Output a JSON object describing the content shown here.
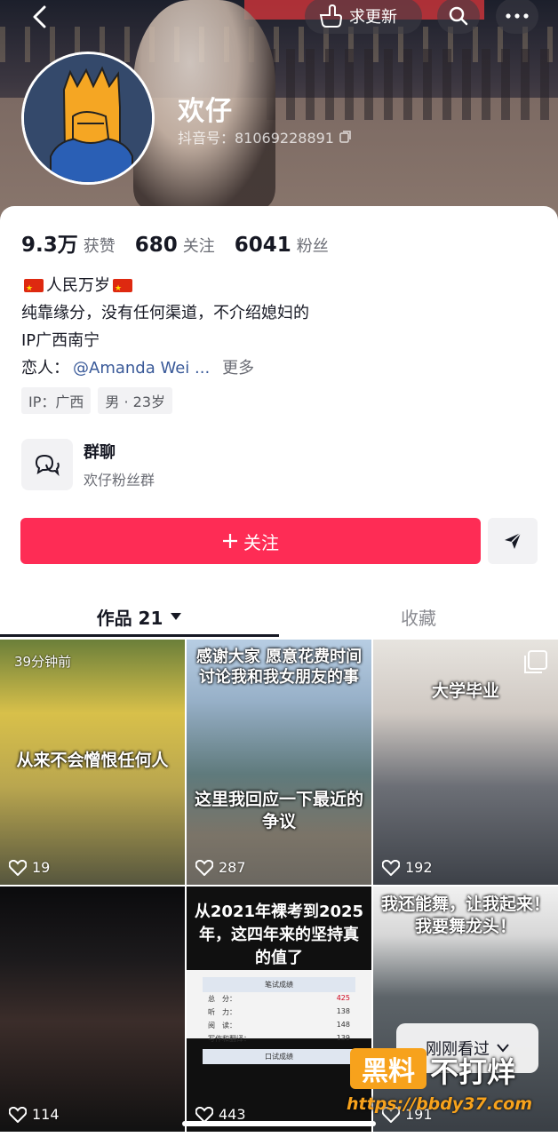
{
  "header": {
    "update_label": "求更新",
    "nickname": "欢仔",
    "douyin_id": "抖音号：81069228891"
  },
  "stats": [
    {
      "num": "9.3万",
      "label": "获赞"
    },
    {
      "num": "680",
      "label": "关注"
    },
    {
      "num": "6041",
      "label": "粉丝"
    }
  ],
  "bio": {
    "line1": "人民万岁",
    "line2": "纯靠缘分，没有任何渠道，不介绍媳妇的",
    "line3": "IP广西南宁",
    "lover_label": "恋人：",
    "lover_mention": "@Amanda Wei ...",
    "more": "更多"
  },
  "tags": [
    "IP：广西",
    "男 · 23岁"
  ],
  "group": {
    "title": "群聊",
    "subtitle": "欢仔粉丝群"
  },
  "actions": {
    "follow_label": "关注"
  },
  "tabs": {
    "works": "作品 21",
    "favorites": "收藏"
  },
  "videos": [
    {
      "ago": "39分钟前",
      "caption": "从来不会憎恨任何人",
      "likes": "19"
    },
    {
      "caption": "感谢大家 愿意花费时间 讨论我和我女朋友的事",
      "caption2": "这里我回应一下最近的争议",
      "likes": "287"
    },
    {
      "caption": "大学毕业",
      "likes": "192"
    },
    {
      "likes": "114"
    },
    {
      "caption": "从2021年裸考到2025年，这四年来的坚持真的值了",
      "likes": "443",
      "score": {
        "title1": "笔试成绩",
        "rows": [
          [
            "听　力：",
            "138"
          ],
          [
            "阅　读：",
            "148"
          ],
          [
            "写作和翻译：",
            "139"
          ]
        ],
        "total": "425",
        "title2": "口试成绩"
      }
    },
    {
      "caption": "我还能舞，让我起来！我要舞龙头！",
      "likes": "191"
    }
  ],
  "toast": {
    "label": "刚刚看过"
  },
  "watermark": {
    "box": "黑料",
    "text": "不打烊",
    "url": "https://bbdy37.com"
  }
}
